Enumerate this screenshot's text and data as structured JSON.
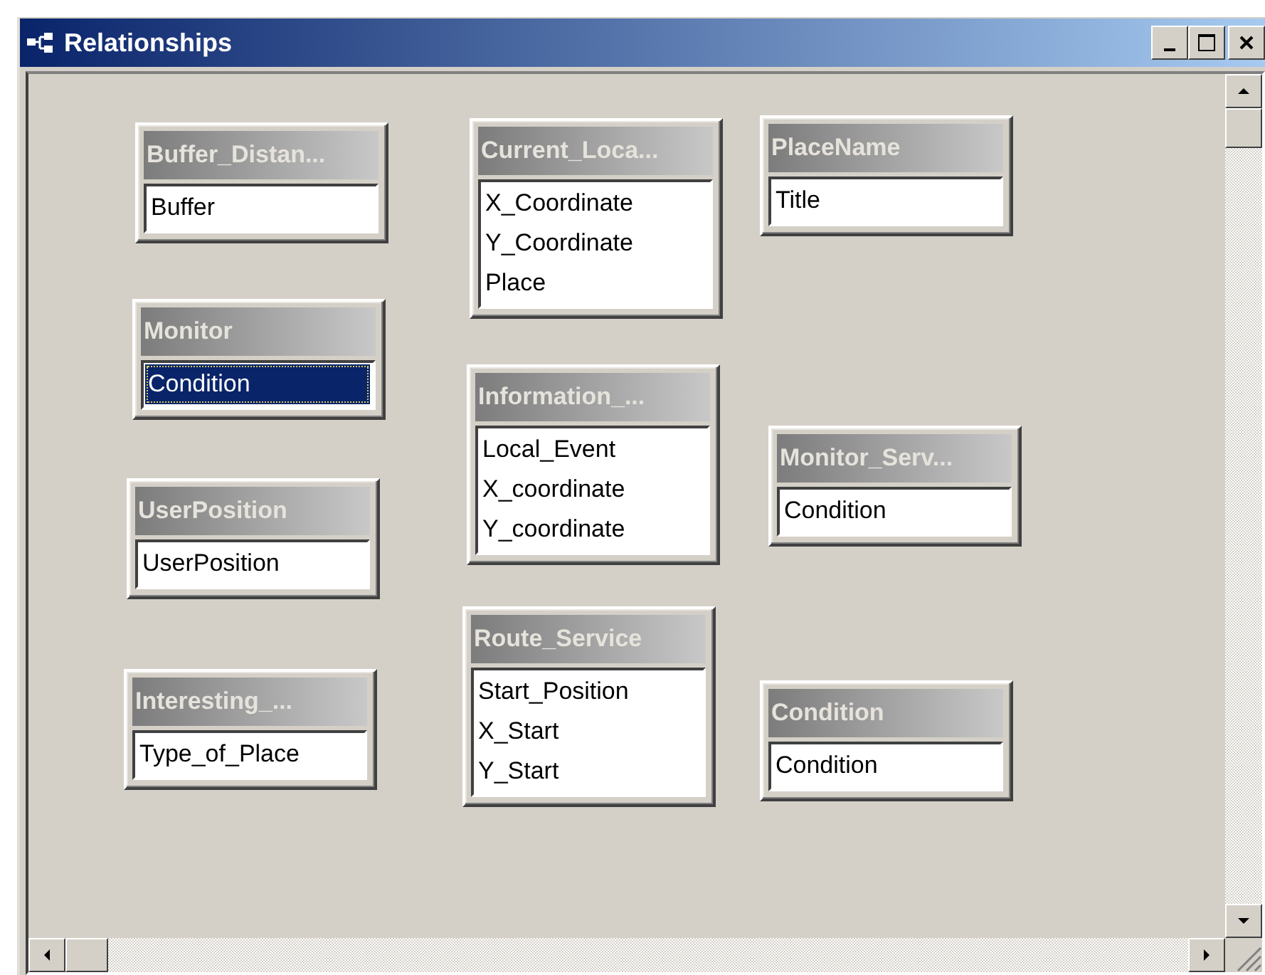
{
  "window": {
    "title": "Relationships"
  },
  "tables": [
    {
      "title": "Buffer_Distan...",
      "fields": [
        {
          "name": "Buffer",
          "selected": false
        }
      ]
    },
    {
      "title": "Monitor",
      "fields": [
        {
          "name": "Condition",
          "selected": true
        }
      ]
    },
    {
      "title": "UserPosition",
      "fields": [
        {
          "name": "UserPosition",
          "selected": false
        }
      ]
    },
    {
      "title": "Interesting_...",
      "fields": [
        {
          "name": "Type_of_Place",
          "selected": false
        }
      ]
    },
    {
      "title": "Current_Loca...",
      "fields": [
        {
          "name": "X_Coordinate",
          "selected": false
        },
        {
          "name": "Y_Coordinate",
          "selected": false
        },
        {
          "name": "Place",
          "selected": false
        }
      ]
    },
    {
      "title": "Information_...",
      "fields": [
        {
          "name": "Local_Event",
          "selected": false
        },
        {
          "name": "X_coordinate",
          "selected": false
        },
        {
          "name": "Y_coordinate",
          "selected": false
        }
      ]
    },
    {
      "title": "Route_Service",
      "fields": [
        {
          "name": "Start_Position",
          "selected": false
        },
        {
          "name": "X_Start",
          "selected": false
        },
        {
          "name": "Y_Start",
          "selected": false
        }
      ]
    },
    {
      "title": "PlaceName",
      "fields": [
        {
          "name": "Title",
          "selected": false
        }
      ]
    },
    {
      "title": "Monitor_Serv...",
      "fields": [
        {
          "name": "Condition",
          "selected": false
        }
      ]
    },
    {
      "title": "Condition",
      "fields": [
        {
          "name": "Condition",
          "selected": false
        }
      ]
    }
  ]
}
